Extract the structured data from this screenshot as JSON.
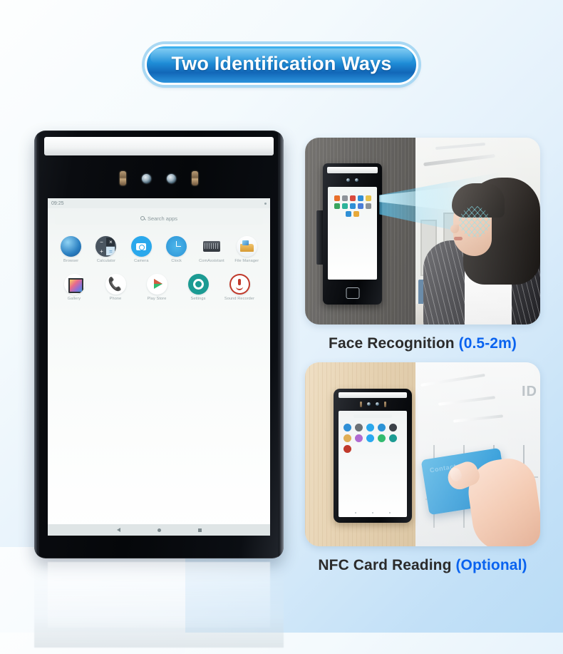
{
  "banner": {
    "title": "Two Identification Ways"
  },
  "device": {
    "status_time": "09:25",
    "search_placeholder": "Search apps",
    "search_icon": "search-icon",
    "apps_row1": [
      {
        "label": "Browser",
        "icon": "browser-icon"
      },
      {
        "label": "Calculator",
        "icon": "calculator-icon"
      },
      {
        "label": "Camera",
        "icon": "camera-icon"
      },
      {
        "label": "Clock",
        "icon": "clock-icon"
      },
      {
        "label": "ComAssistant",
        "icon": "comassistant-icon"
      },
      {
        "label": "File Manager",
        "icon": "file-manager-icon"
      }
    ],
    "apps_row2": [
      {
        "label": "Gallery",
        "icon": "gallery-icon"
      },
      {
        "label": "Phone",
        "icon": "phone-icon"
      },
      {
        "label": "Play Store",
        "icon": "play-store-icon"
      },
      {
        "label": "Settings",
        "icon": "settings-icon"
      },
      {
        "label": "Sound Recorder",
        "icon": "sound-recorder-icon"
      }
    ],
    "nav": {
      "back": "back-icon",
      "home": "home-icon",
      "recents": "recents-icon"
    },
    "calculator_glyphs": {
      "minus": "−",
      "close": "×",
      "plus": "+",
      "equals": "="
    },
    "phone_glyph": "📞"
  },
  "features": [
    {
      "caption_main": "Face Recognition",
      "caption_highlight": "(0.5-2m)",
      "scene": "wall-mounted terminal scanning a woman's face"
    },
    {
      "caption_main": "NFC Card Reading",
      "caption_highlight": "(Optional)",
      "scene": "hand holding blue NFC card near wall terminal",
      "wall_text": "ID",
      "card_brand": "Contact"
    }
  ],
  "colors": {
    "banner_blue": "#1f8ed8",
    "highlight_blue": "#0a63ef",
    "caption_dark": "#2b2b2b",
    "background_top": "#fdfefe",
    "background_bottom": "#b9dcf6",
    "beam_cyan": "#5ac8f5",
    "card_blue": "#1f93d6"
  }
}
